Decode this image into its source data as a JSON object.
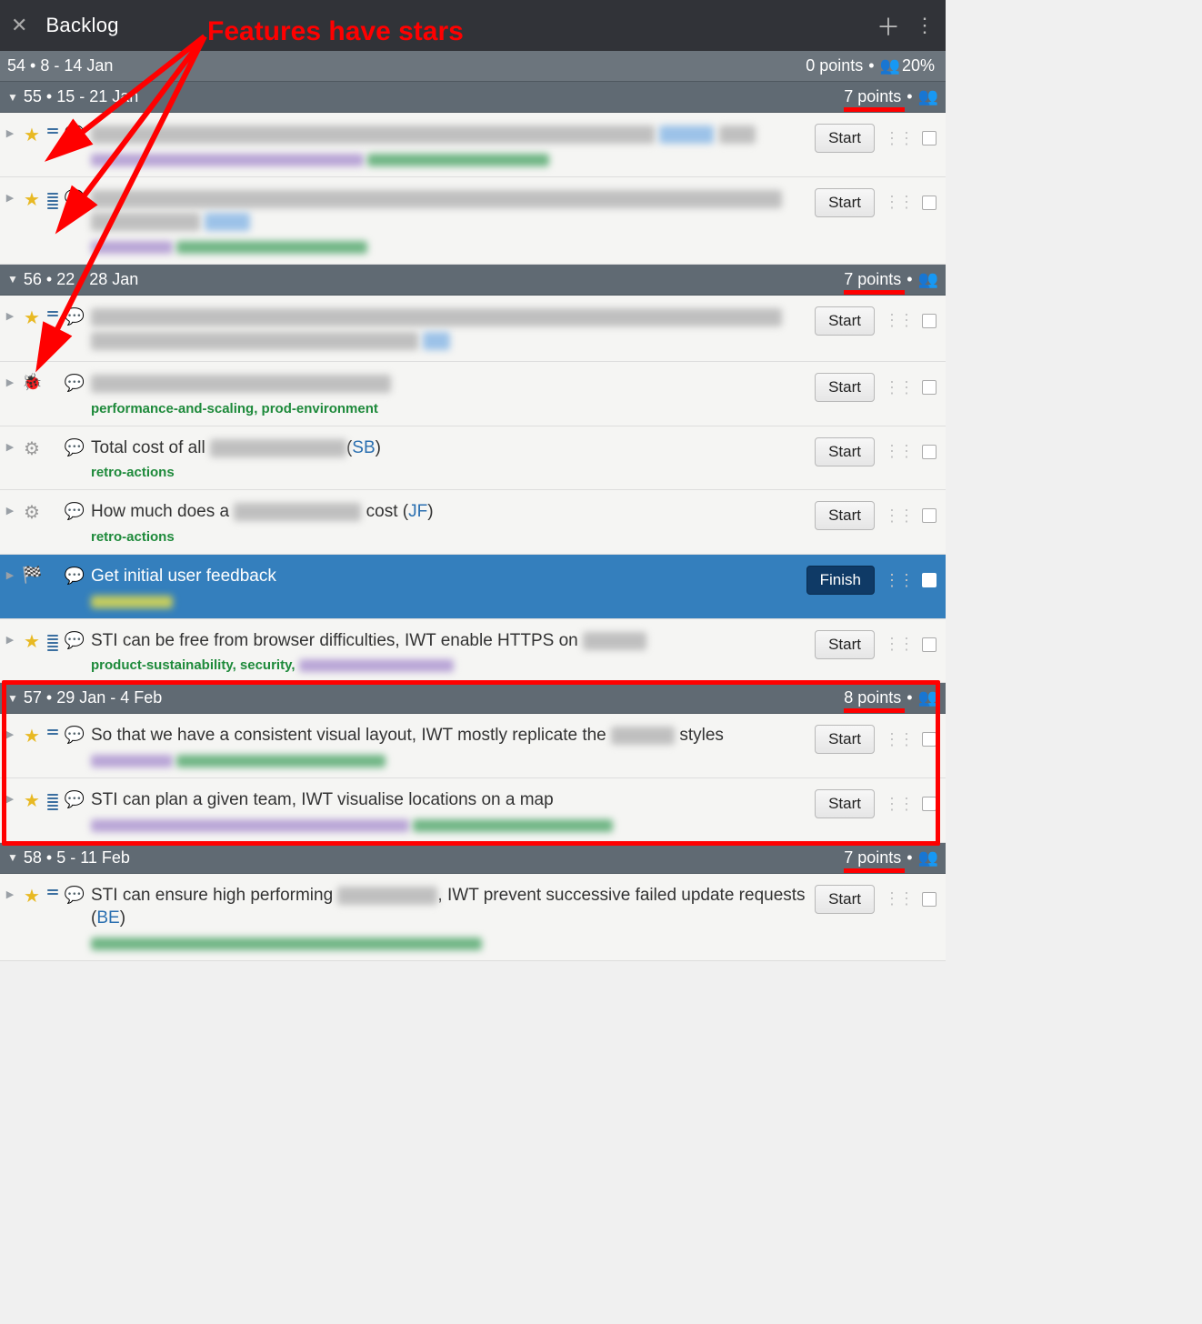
{
  "header": {
    "title": "Backlog"
  },
  "annotation": {
    "label": "Features have stars"
  },
  "iterations": [
    {
      "num": "54",
      "dates": "8 - 14 Jan",
      "points": "0 points",
      "cap_text": "20%",
      "collapsed": true,
      "red_underline": false
    },
    {
      "num": "55",
      "dates": "15 - 21 Jan",
      "points": "7 points",
      "collapsed": false,
      "red_underline": true
    },
    {
      "num": "56",
      "dates": "22 - 28 Jan",
      "points": "7 points",
      "collapsed": false,
      "red_underline": true
    },
    {
      "num": "57",
      "dates": "29 Jan - 4 Feb",
      "points": "8 points",
      "collapsed": false,
      "red_underline": true
    },
    {
      "num": "58",
      "dates": "5 - 11 Feb",
      "points": "7 points",
      "collapsed": false,
      "red_underline": true
    }
  ],
  "buttons": {
    "start": "Start",
    "finish": "Finish"
  },
  "stories": {
    "s55_1": {
      "type": "feature",
      "est": 2
    },
    "s55_2": {
      "type": "feature",
      "est": 5
    },
    "s56_1": {
      "type": "feature",
      "est": 2
    },
    "s56_2": {
      "type": "bug",
      "labels": "performance-and-scaling, prod-environment"
    },
    "s56_3": {
      "type": "chore",
      "title_pre": "Total cost of all ",
      "initials": "SB",
      "labels": "retro-actions"
    },
    "s56_4": {
      "type": "chore",
      "title_pre": "How much does a ",
      "title_post": " cost ",
      "initials": "JF",
      "labels": "retro-actions"
    },
    "s56_5": {
      "type": "release",
      "title": "Get initial user feedback",
      "button": "Finish"
    },
    "s56_6": {
      "type": "feature",
      "est": 5,
      "title": "STI can be free from browser difficulties, IWT enable HTTPS on ",
      "labels": "product-sustainability, security, "
    },
    "s57_1": {
      "type": "feature",
      "est": 2,
      "title": "So that we have a consistent visual layout, IWT mostly replicate the ",
      "title_post": "styles"
    },
    "s57_2": {
      "type": "feature",
      "est": 5,
      "title": "STI can plan a given team, IWT visualise locations on a map"
    },
    "s58_1": {
      "type": "feature",
      "est": 2,
      "title_pre": "STI can ensure high performing ",
      "title_post": ", IWT prevent successive failed update requests (",
      "initials": "BE",
      "tail": ")"
    }
  }
}
